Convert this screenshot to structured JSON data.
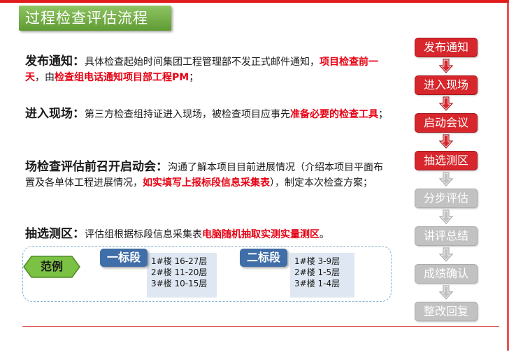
{
  "title": "过程检查评估流程",
  "sections": [
    {
      "head": "发布通知：",
      "segments": [
        {
          "text": "具体检查起始时间集团工程管理部不发正式邮件通知，",
          "red": false
        },
        {
          "text": "项目检查前一天",
          "red": true
        },
        {
          "text": "，由",
          "red": false
        },
        {
          "text": "检查组电话通知项目部工程PM",
          "red": true
        },
        {
          "text": "；",
          "red": false
        }
      ]
    },
    {
      "head": "进入现场：",
      "segments": [
        {
          "text": "第三方检查组持证进入现场，被检查项目应事先",
          "red": false
        },
        {
          "text": "准备必要的检查工具",
          "red": true
        },
        {
          "text": "；",
          "red": false
        }
      ]
    },
    {
      "head": "场检查评估前召开启动会：",
      "segments": [
        {
          "text": "沟通了解本项目目前进展情况（介绍本项目平面布置及各单体工程进展情况，",
          "red": false
        },
        {
          "text": "如实填写上报标段信息采集表",
          "red": true
        },
        {
          "text": "），制定本次检查方案；",
          "red": false
        }
      ]
    },
    {
      "head": "抽选测区：",
      "segments": [
        {
          "text": "评估组根据标段信息采集表",
          "red": false
        },
        {
          "text": "电脑随机抽取实测实量测区",
          "red": true
        },
        {
          "text": "。",
          "red": false
        }
      ]
    }
  ],
  "example": {
    "badge": "范例",
    "segments": [
      {
        "name": "一标段",
        "items": [
          "1#楼 16-27层",
          "2#楼 11-20层",
          "3#楼 10-15层"
        ]
      },
      {
        "name": "二标段",
        "items": [
          "1#楼 3-9层",
          "2#楼 1-5层",
          "3#楼 1-4层"
        ]
      }
    ]
  },
  "flow": {
    "steps": [
      {
        "label": "发布通知",
        "active": true
      },
      {
        "label": "进入现场",
        "active": true
      },
      {
        "label": "启动会议",
        "active": true
      },
      {
        "label": "抽选测区",
        "active": true
      },
      {
        "label": "分步评估",
        "active": false
      },
      {
        "label": "讲评总结",
        "active": false
      },
      {
        "label": "成绩确认",
        "active": false
      },
      {
        "label": "整改回复",
        "active": false
      }
    ]
  },
  "colors": {
    "accent_red": "#e60012",
    "title_green": "#6aa83d",
    "segment_blue": "#3f6ea8",
    "inactive_gray": "#c2c2c2"
  }
}
